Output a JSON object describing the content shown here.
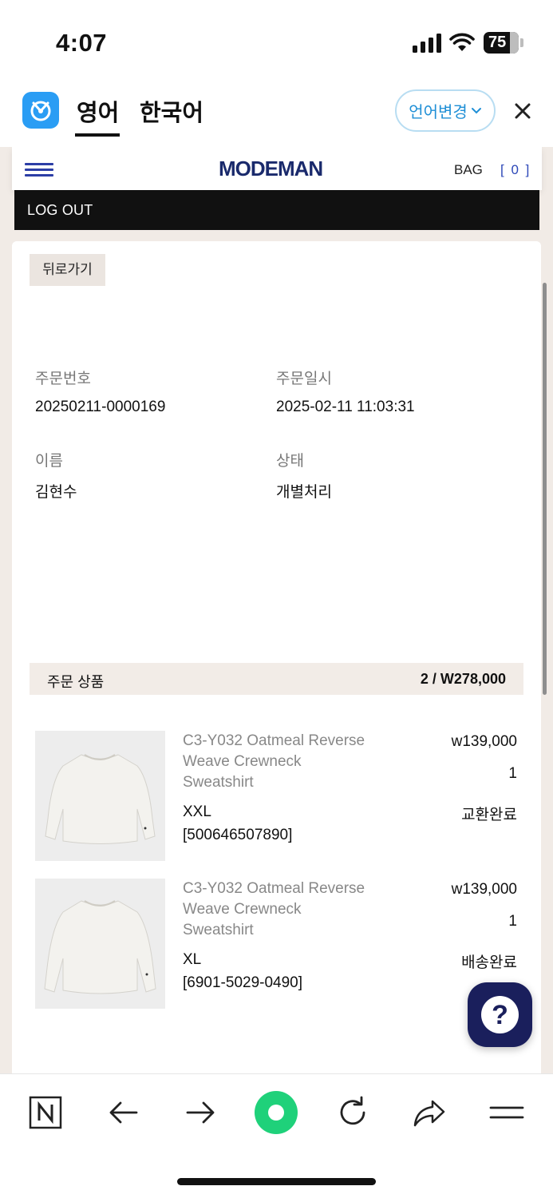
{
  "status_bar": {
    "time": "4:07",
    "battery": "75"
  },
  "translator": {
    "tab_english": "영어",
    "tab_korean": "한국어",
    "change_language": "언어변경"
  },
  "site": {
    "brand": "MODEMAN",
    "bag_label": "BAG",
    "bag_count": "[ 0 ]",
    "logout": "LOG OUT"
  },
  "order": {
    "back_label": "뒤로가기",
    "order_number_label": "주문번호",
    "order_number": "20250211-0000169",
    "order_date_label": "주문일시",
    "order_date": "2025-02-11 11:03:31",
    "name_label": "이름",
    "name": "김현수",
    "status_label": "상태",
    "status": "개별처리"
  },
  "items_section": {
    "title": "주문 상품",
    "total": "2 / W278,000"
  },
  "items": [
    {
      "name": "C3-Y032 Oatmeal Reverse Weave Crewneck Sweatshirt",
      "size": "XXL",
      "code": "[500646507890]",
      "price": "w139,000",
      "qty": "1",
      "status": "교환완료"
    },
    {
      "name": "C3-Y032 Oatmeal Reverse Weave Crewneck Sweatshirt",
      "size": "XL",
      "code": "[6901-5029-0490]",
      "price": "w139,000",
      "qty": "1",
      "status": "배송완료"
    }
  ],
  "help": {
    "symbol": "?"
  },
  "colors": {
    "accent_blue": "#2c3ea6",
    "brand_navy": "#1a2a6c",
    "translator_blue": "#1f8fd6",
    "frame_beige": "#f1ebe6",
    "toolbar_green": "#1fd17a"
  }
}
